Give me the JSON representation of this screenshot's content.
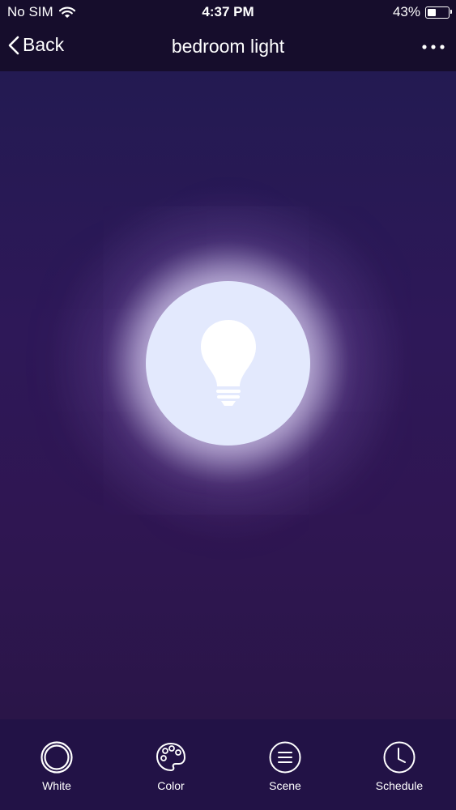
{
  "status_bar": {
    "carrier": "No SIM",
    "time": "4:37 PM",
    "battery_percent": "43%",
    "battery_level": 0.43,
    "wifi_icon": "wifi-icon",
    "battery_icon": "battery-icon"
  },
  "nav": {
    "back_label": "Back",
    "title": "bedroom light",
    "back_icon": "chevron-left-icon",
    "more_icon": "more-horizontal-icon"
  },
  "device": {
    "power_icon": "lightbulb-icon",
    "glow_color": "#e3e9fd"
  },
  "tabs": [
    {
      "label": "White",
      "icon": "white-ring-icon"
    },
    {
      "label": "Color",
      "icon": "palette-icon"
    },
    {
      "label": "Scene",
      "icon": "scene-lines-icon"
    },
    {
      "label": "Schedule",
      "icon": "clock-icon"
    }
  ],
  "colors": {
    "header_bg": "#160d2c",
    "tab_bar_bg": "#221246",
    "main_bg": "#2e1858",
    "text": "#ffffff"
  }
}
